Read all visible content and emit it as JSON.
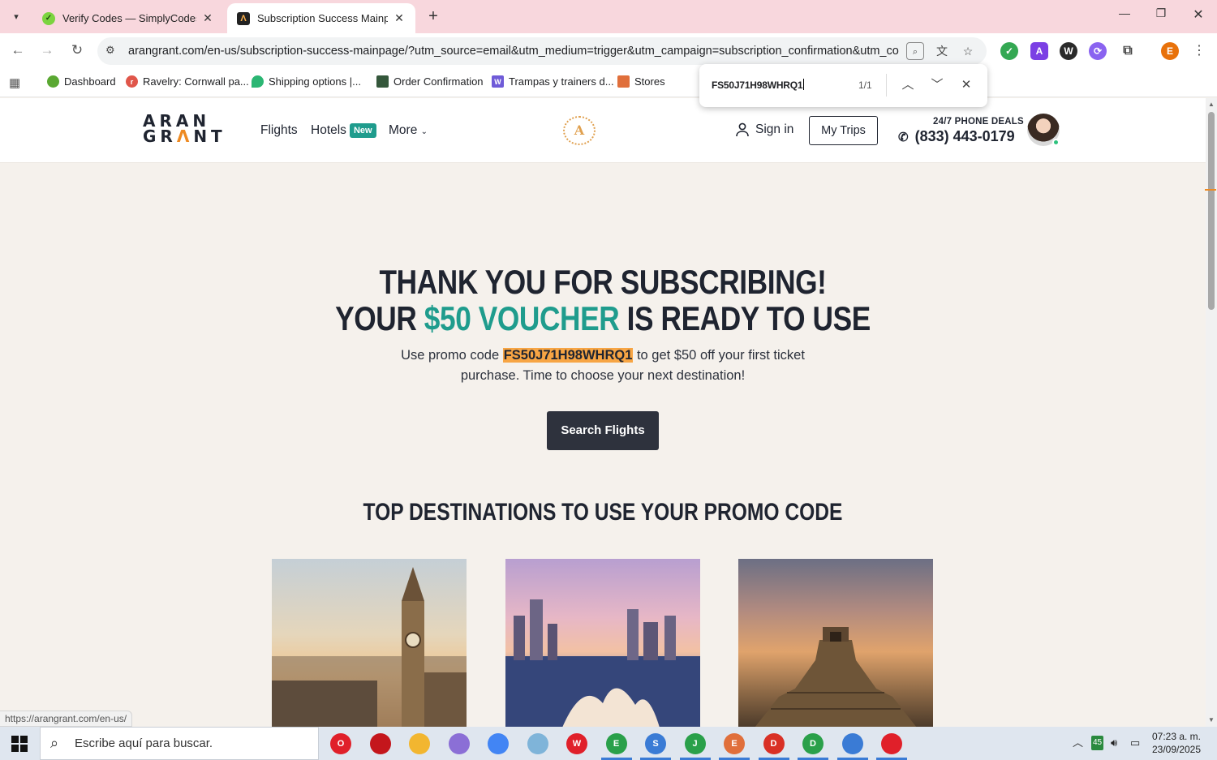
{
  "browser": {
    "tabs": [
      {
        "title": "Verify Codes — SimplyCodes",
        "active": false,
        "favicon": "simplycodes-favicon"
      },
      {
        "title": "Subscription Success Mainpage",
        "active": true,
        "favicon": "arangrant-favicon"
      }
    ],
    "url": "arangrant.com/en-us/subscription-success-mainpage/?utm_source=email&utm_medium=trigger&utm_campaign=subscription_confirmation&utm_con...",
    "bookmarks": [
      {
        "label": "Dashboard",
        "color": "#5aa832"
      },
      {
        "label": "Ravelry: Cornwall pa...",
        "color": "#e0564a"
      },
      {
        "label": "Shipping options |...",
        "color": "#2bb673"
      },
      {
        "label": "Order Confirmation",
        "color": "#34573b"
      },
      {
        "label": "Trampas y trainers d...",
        "color": "#6f5bd8"
      },
      {
        "label": "Stores",
        "color": "#e06f3b"
      }
    ],
    "extension_profile_letter": "E",
    "find": {
      "query": "FS50J71H98WHRQ1",
      "count": "1/1"
    },
    "status_url": "https://arangrant.com/en-us/"
  },
  "site": {
    "logo_line1": "ARAN",
    "logo_line2_a": "GR",
    "logo_line2_accent": "Λ",
    "logo_line2_b": "NT",
    "nav": {
      "flights": "Flights",
      "hotels": "Hotels",
      "hotels_badge": "New",
      "more": "More"
    },
    "laurel_letter": "A",
    "sign_in": "Sign in",
    "my_trips": "My Trips",
    "phone_deals": "24/7 PHONE DEALS",
    "phone_number": "(833) 443-0179"
  },
  "hero": {
    "line1": "THANK YOU FOR SUBSCRIBING!",
    "line2_before": "YOUR ",
    "line2_voucher": "$50 VOUCHER",
    "line2_after": " IS READY TO USE",
    "promo_before": "Use promo code ",
    "promo_code": "FS50J71H98WHRQ1",
    "promo_after": " to get $50 off your first ticket purchase. Time to choose your next destination!",
    "search_button": "Search Flights",
    "destinations_title": "TOP DESTINATIONS TO USE YOUR PROMO CODE"
  },
  "colors": {
    "accent_teal": "#1f9c8d",
    "accent_orange": "#ee8a22",
    "highlight": "#f7a544",
    "dark": "#1f2430",
    "page_bg": "#f5f1ec"
  },
  "taskbar": {
    "search_placeholder": "Escribe aquí para buscar.",
    "apps": [
      {
        "icon": "opera-icon",
        "letter": "O",
        "color": "#e0202a"
      },
      {
        "icon": "app-red-icon",
        "letter": "",
        "color": "#c4161c"
      },
      {
        "icon": "file-explorer-icon",
        "letter": "",
        "color": "#f2b630"
      },
      {
        "icon": "pen-icon",
        "letter": "",
        "color": "#8b6fd6"
      },
      {
        "icon": "chrome-icon",
        "letter": "",
        "color": "#4285f4"
      },
      {
        "icon": "notepad-icon",
        "letter": "",
        "color": "#7fb4d9"
      },
      {
        "icon": "wps-icon",
        "letter": "W",
        "color": "#e0202a"
      },
      {
        "icon": "chrome-profile-e-icon",
        "letter": "E",
        "color": "#2aa04a"
      },
      {
        "icon": "chrome-profile-s-icon",
        "letter": "S",
        "color": "#3a7bd5"
      },
      {
        "icon": "chrome-profile-j-icon",
        "letter": "J",
        "color": "#2aa04a"
      },
      {
        "icon": "chrome-profile-e2-icon",
        "letter": "E",
        "color": "#e06f3b"
      },
      {
        "icon": "chrome-profile-d-icon",
        "letter": "D",
        "color": "#d93025"
      },
      {
        "icon": "chrome-profile-d2-icon",
        "letter": "D",
        "color": "#2aa04a"
      },
      {
        "icon": "chrome-profile-globe-icon",
        "letter": "",
        "color": "#3a7bd5"
      },
      {
        "icon": "chrome-profile-user-icon",
        "letter": "",
        "color": "#e0202a"
      }
    ],
    "tray_badge": "45",
    "time": "07:23 a. m.",
    "date": "23/09/2025"
  }
}
